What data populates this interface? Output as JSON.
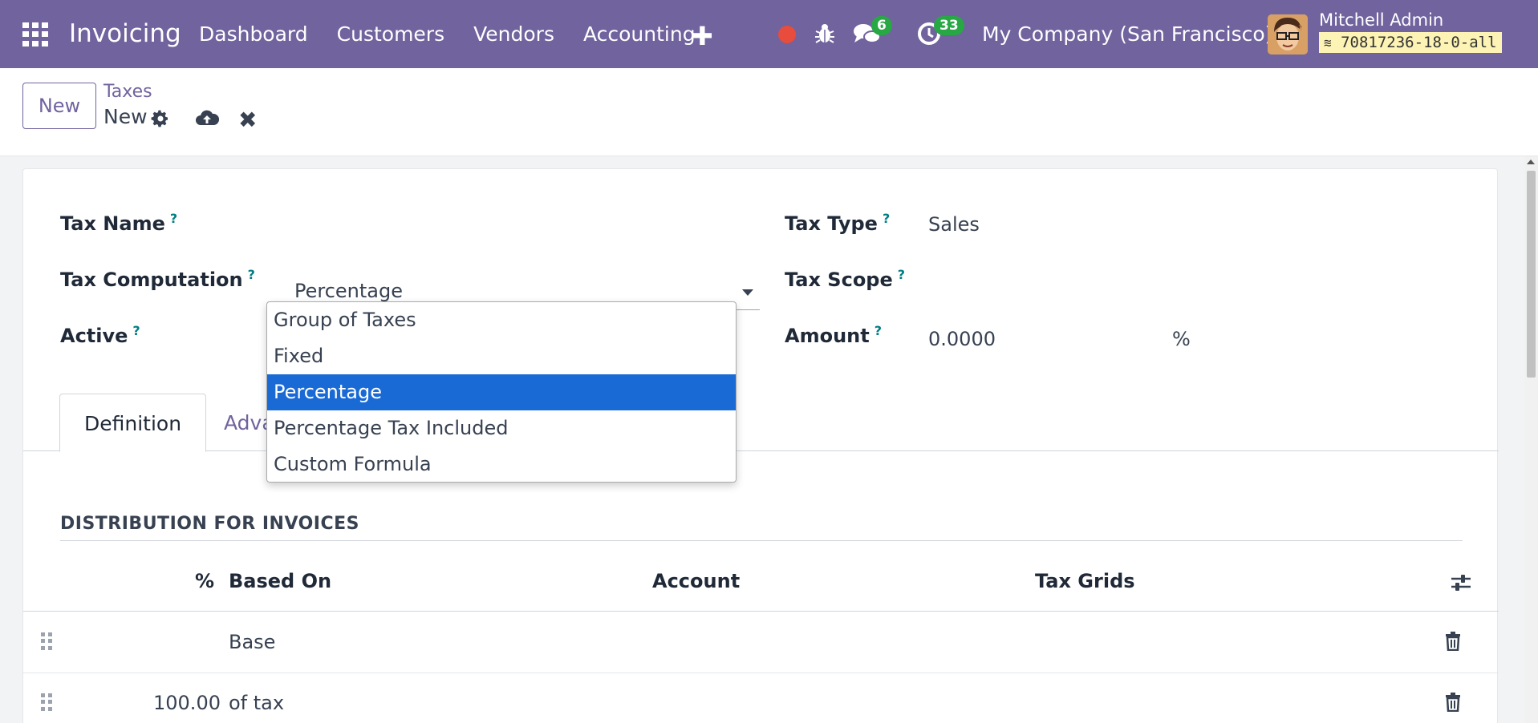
{
  "navbar": {
    "app_name": "Invoicing",
    "menu": [
      "Dashboard",
      "Customers",
      "Vendors",
      "Accounting"
    ],
    "chat_count": "6",
    "activity_count": "33",
    "company": "My Company (San Francisco)",
    "user_name": "Mitchell Admin",
    "database": "70817236-18-0-all",
    "colors": {
      "bar": "#71639e",
      "badge": "#28a745",
      "record": "#e74c3c"
    }
  },
  "control": {
    "new_label": "New",
    "breadcrumb_parent": "Taxes",
    "breadcrumb_current": "New"
  },
  "form": {
    "tax_name_label": "Tax Name",
    "tax_computation_label": "Tax Computation",
    "tax_computation_value": "Percentage",
    "active_label": "Active",
    "tax_type_label": "Tax Type",
    "tax_type_value": "Sales",
    "tax_scope_label": "Tax Scope",
    "amount_label": "Amount",
    "amount_value": "0.0000",
    "amount_unit": "%",
    "help_mark": "?"
  },
  "dropdown": {
    "options": [
      "Group of Taxes",
      "Fixed",
      "Percentage",
      "Percentage Tax Included",
      "Custom Formula"
    ],
    "selected": "Percentage",
    "highlight_color": "#1a6ad6"
  },
  "tabs": {
    "definition": "Definition",
    "advanced": "Adva"
  },
  "distribution": {
    "title": "DISTRIBUTION FOR INVOICES",
    "columns": [
      "%",
      "Based On",
      "Account",
      "Tax Grids"
    ],
    "rows": [
      {
        "percent": "",
        "based_on": "Base"
      },
      {
        "percent": "100.00",
        "based_on": "of tax"
      }
    ]
  }
}
